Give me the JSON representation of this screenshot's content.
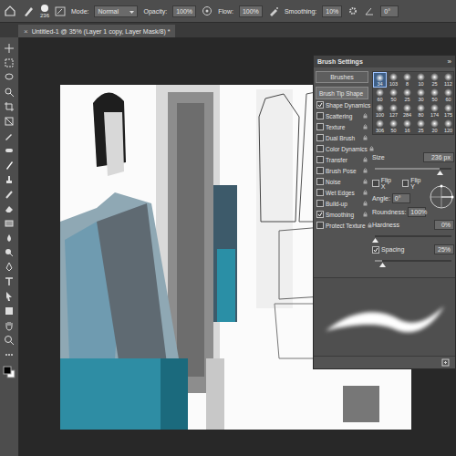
{
  "options_bar": {
    "brush_size": "236",
    "mode_label": "Mode:",
    "mode": "Normal",
    "opacity_label": "Opacity:",
    "opacity": "100%",
    "flow_label": "Flow:",
    "flow": "100%",
    "smoothing_label": "Smoothing:",
    "smoothing": "10%",
    "angle": "0°"
  },
  "document_tab": {
    "close": "×",
    "title": "Untitled-1 @ 35% (Layer 1 copy, Layer Mask/8) *",
    "selected": true
  },
  "brush_panel": {
    "title": "Brush Settings",
    "menu": "»",
    "brushes_button": "Brushes",
    "options": [
      {
        "label": "Brush Tip Shape",
        "kind": "heading",
        "selected": true
      },
      {
        "label": "Shape Dynamics",
        "kind": "checkbox",
        "checked": true,
        "selected": false
      },
      {
        "label": "Scattering",
        "kind": "checkbox",
        "checked": false,
        "selected": false
      },
      {
        "label": "Texture",
        "kind": "checkbox",
        "checked": false,
        "selected": false
      },
      {
        "label": "Dual Brush",
        "kind": "checkbox",
        "checked": false,
        "selected": false
      },
      {
        "label": "Color Dynamics",
        "kind": "checkbox",
        "checked": false,
        "selected": false
      },
      {
        "label": "Transfer",
        "kind": "checkbox",
        "checked": false,
        "selected": false
      },
      {
        "label": "Brush Pose",
        "kind": "checkbox",
        "checked": false,
        "selected": false
      },
      {
        "label": "Noise",
        "kind": "checkbox",
        "checked": false,
        "selected": false
      },
      {
        "label": "Wet Edges",
        "kind": "checkbox",
        "checked": false,
        "selected": false
      },
      {
        "label": "Build-up",
        "kind": "checkbox",
        "checked": false,
        "selected": false
      },
      {
        "label": "Smoothing",
        "kind": "checkbox",
        "checked": true,
        "selected": false
      },
      {
        "label": "Protect Texture",
        "kind": "checkbox",
        "checked": false,
        "selected": false
      }
    ],
    "presets": [
      {
        "size": "34",
        "selected": true
      },
      {
        "size": "103",
        "selected": false
      },
      {
        "size": "8",
        "selected": false
      },
      {
        "size": "10",
        "selected": false
      },
      {
        "size": "25",
        "selected": false
      },
      {
        "size": "112",
        "selected": false
      },
      {
        "size": "60",
        "selected": false
      },
      {
        "size": "50",
        "selected": false
      },
      {
        "size": "25",
        "selected": false
      },
      {
        "size": "30",
        "selected": false
      },
      {
        "size": "50",
        "selected": false
      },
      {
        "size": "60",
        "selected": false
      },
      {
        "size": "100",
        "selected": false
      },
      {
        "size": "127",
        "selected": false
      },
      {
        "size": "284",
        "selected": false
      },
      {
        "size": "80",
        "selected": false
      },
      {
        "size": "174",
        "selected": false
      },
      {
        "size": "175",
        "selected": false
      },
      {
        "size": "306",
        "selected": false
      },
      {
        "size": "50",
        "selected": false
      },
      {
        "size": "16",
        "selected": false
      },
      {
        "size": "25",
        "selected": false
      },
      {
        "size": "20",
        "selected": false
      },
      {
        "size": "120",
        "selected": false
      }
    ],
    "size": {
      "label": "Size",
      "value": "236 px",
      "level": 0.85
    },
    "flip_x": {
      "label": "Flip X",
      "checked": false
    },
    "flip_y": {
      "label": "Flip Y",
      "checked": false
    },
    "angle": {
      "label": "Angle:",
      "value": "0°"
    },
    "roundness": {
      "label": "Roundness:",
      "value": "100%"
    },
    "hardness": {
      "label": "Hardness",
      "value": "0%",
      "level": 0.0
    },
    "spacing": {
      "label": "Spacing",
      "value": "25%",
      "checked": true,
      "level": 0.1
    }
  }
}
